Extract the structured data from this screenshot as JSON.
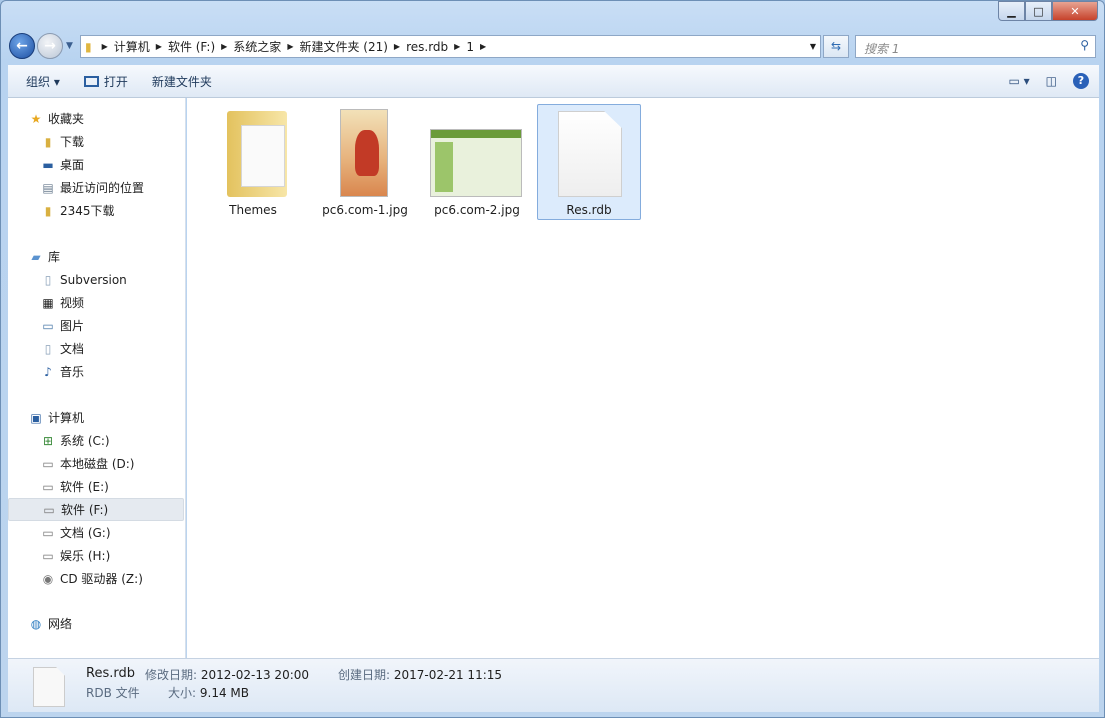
{
  "window": {
    "minimize": "▁",
    "maximize": "□",
    "close": "✕"
  },
  "address": {
    "segments": [
      "计算机",
      "软件 (F:)",
      "系统之家",
      "新建文件夹 (21)",
      "res.rdb",
      "1"
    ]
  },
  "search": {
    "placeholder": "搜索 1"
  },
  "toolbar": {
    "organize": "组织 ▾",
    "open": "打开",
    "new_folder": "新建文件夹"
  },
  "sidebar": {
    "favorites": {
      "label": "收藏夹",
      "items": [
        "下载",
        "桌面",
        "最近访问的位置",
        "2345下载"
      ]
    },
    "libraries": {
      "label": "库",
      "items": [
        "Subversion",
        "视频",
        "图片",
        "文档",
        "音乐"
      ]
    },
    "computer": {
      "label": "计算机",
      "items": [
        "系统 (C:)",
        "本地磁盘 (D:)",
        "软件 (E:)",
        "软件 (F:)",
        "文档 (G:)",
        "娱乐 (H:)",
        "CD 驱动器 (Z:)"
      ]
    },
    "network": {
      "label": "网络"
    }
  },
  "files": [
    {
      "name": "Themes",
      "type": "folder"
    },
    {
      "name": "pc6.com-1.jpg",
      "type": "image"
    },
    {
      "name": "pc6.com-2.jpg",
      "type": "image"
    },
    {
      "name": "Res.rdb",
      "type": "file",
      "selected": true
    }
  ],
  "details": {
    "name": "Res.rdb",
    "type": "RDB 文件",
    "modified_label": "修改日期:",
    "modified": "2012-02-13 20:00",
    "created_label": "创建日期:",
    "created": "2017-02-21 11:15",
    "size_label": "大小:",
    "size": "9.14 MB"
  }
}
